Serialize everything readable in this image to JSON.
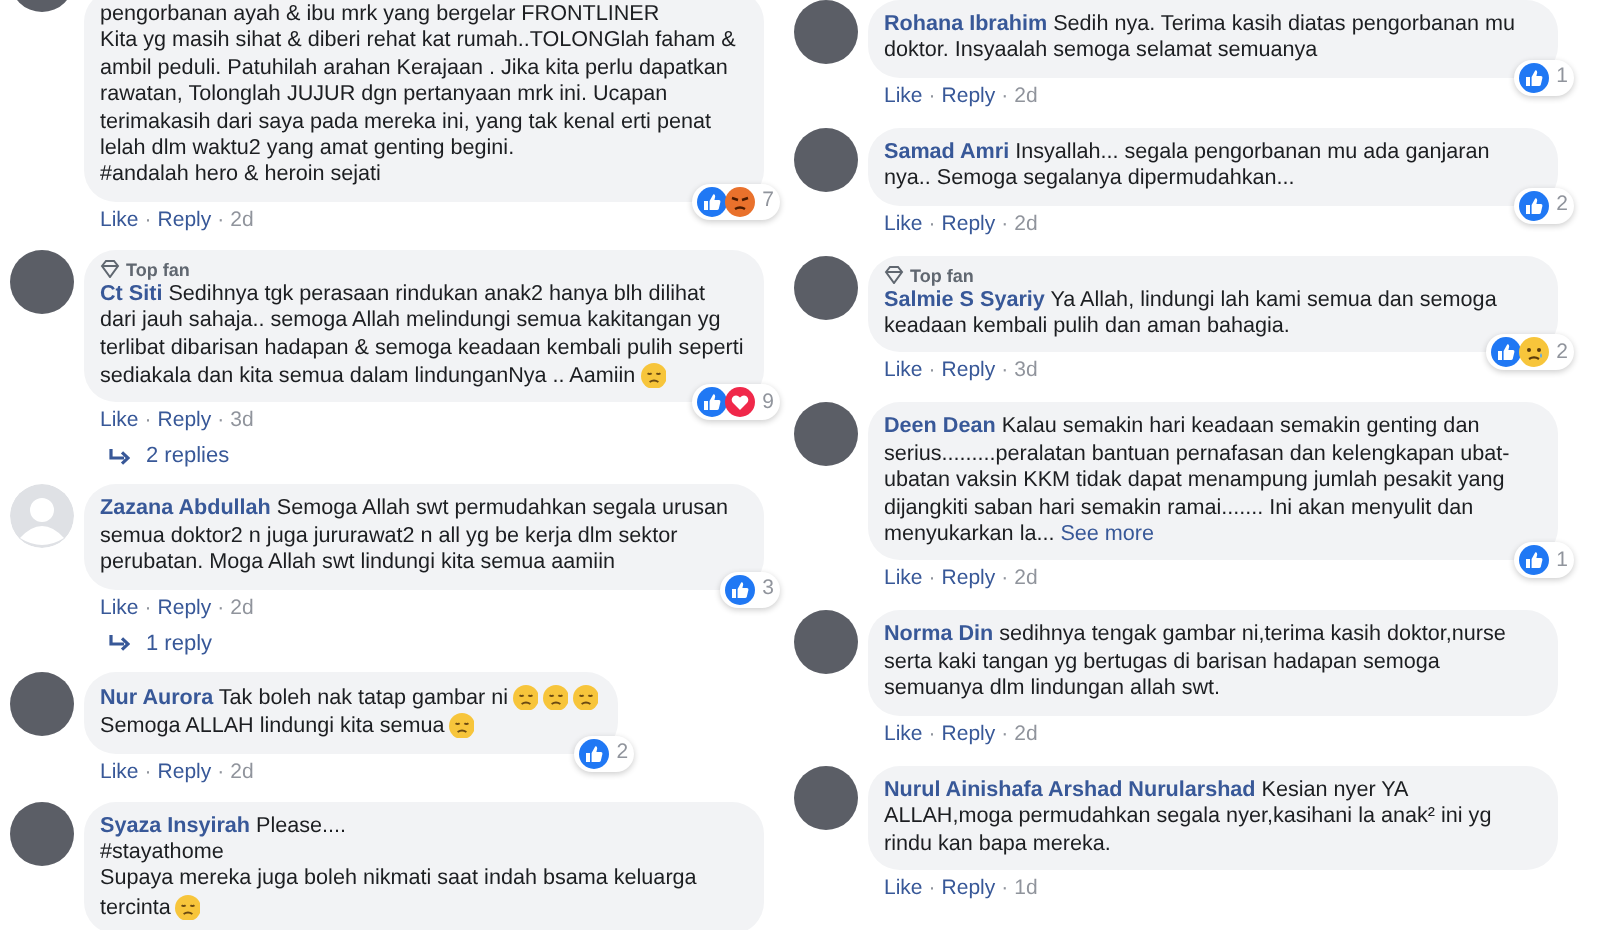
{
  "columns": [
    {
      "comments": [
        {
          "avatar": {
            "kind": "photo"
          },
          "paragraphs": [
            [
              {
                "kind": "text",
                "text": "pengorbanan ayah & ibu mrk yang bergelar FRONTLINER"
              }
            ],
            [
              {
                "kind": "text",
                "text": "Kita yg masih sihat & diberi rehat kat rumah..TOLONGlah faham & ambil peduli. Patuhilah arahan Kerajaan . Jika kita perlu dapatkan rawatan, Tolonglah JUJUR dgn pertanyaan mrk ini. Ucapan terimakasih dari saya pada mereka ini, yang tak kenal erti penat lelah dlm waktu2 yang amat genting begini."
              }
            ],
            [
              {
                "kind": "text",
                "text": "#andalah hero & heroin sejati"
              }
            ]
          ],
          "reactions": {
            "icons": [
              {
                "kind": "like"
              },
              {
                "kind": "angry"
              }
            ],
            "count": "7"
          },
          "actions": [
            {
              "kind": "link",
              "text": "Like"
            },
            {
              "kind": "sep",
              "text": "·"
            },
            {
              "kind": "link",
              "text": "Reply"
            },
            {
              "kind": "sep",
              "text": "·"
            },
            {
              "kind": "time",
              "text": "2d"
            }
          ]
        },
        {
          "author": "Ct Siti",
          "avatar": {
            "kind": "photo"
          },
          "top_fan_label": "Top fan",
          "paragraphs": [
            [
              {
                "kind": "text",
                "text": "Sedihnya tgk perasaan rindukan anak2 hanya blh dilihat dari jauh sahaja.. semoga Allah melindungi semua kakitangan yg terlibat dibarisan hadapan & semoga keadaan kembali pulih seperti sediakala dan kita semua dalam lindunganNya .. Aamiin"
              },
              {
                "kind": "emoji"
              }
            ]
          ],
          "reactions": {
            "icons": [
              {
                "kind": "like"
              },
              {
                "kind": "love"
              }
            ],
            "count": "9"
          },
          "actions": [
            {
              "kind": "link",
              "text": "Like"
            },
            {
              "kind": "sep",
              "text": "·"
            },
            {
              "kind": "link",
              "text": "Reply"
            },
            {
              "kind": "sep",
              "text": "·"
            },
            {
              "kind": "time",
              "text": "3d"
            }
          ],
          "replies": "2 replies"
        },
        {
          "author": "Zazana Abdullah",
          "avatar": {
            "kind": "default"
          },
          "paragraphs": [
            [
              {
                "kind": "text",
                "text": "Semoga Allah swt permudahkan segala urusan semua doktor2 n juga jururawat2 n all yg be kerja dlm sektor perubatan. Moga Allah swt lindungi kita semua aamiin"
              }
            ]
          ],
          "reactions": {
            "icons": [
              {
                "kind": "like"
              }
            ],
            "count": "3"
          },
          "actions": [
            {
              "kind": "link",
              "text": "Like"
            },
            {
              "kind": "sep",
              "text": "·"
            },
            {
              "kind": "link",
              "text": "Reply"
            },
            {
              "kind": "sep",
              "text": "·"
            },
            {
              "kind": "time",
              "text": "2d"
            }
          ],
          "replies": "1 reply"
        },
        {
          "author": "Nur Aurora",
          "avatar": {
            "kind": "photo"
          },
          "paragraphs": [
            [
              {
                "kind": "text",
                "text": "Tak boleh nak tatap gambar ni"
              },
              {
                "kind": "emoji"
              },
              {
                "kind": "emoji"
              },
              {
                "kind": "emoji"
              }
            ],
            [
              {
                "kind": "text",
                "text": "Semoga ALLAH lindungi kita semua"
              },
              {
                "kind": "emoji"
              }
            ]
          ],
          "reactions": {
            "icons": [
              {
                "kind": "like"
              }
            ],
            "count": "2"
          },
          "actions": [
            {
              "kind": "link",
              "text": "Like"
            },
            {
              "kind": "sep",
              "text": "·"
            },
            {
              "kind": "link",
              "text": "Reply"
            },
            {
              "kind": "sep",
              "text": "·"
            },
            {
              "kind": "time",
              "text": "2d"
            }
          ]
        },
        {
          "author": "Syaza Insyirah",
          "avatar": {
            "kind": "photo"
          },
          "paragraphs": [
            [
              {
                "kind": "text",
                "text": "Please...."
              }
            ],
            [
              {
                "kind": "text",
                "text": "#stayathome"
              }
            ],
            [
              {
                "kind": "text",
                "text": "Supaya mereka juga boleh nikmati saat indah bsama keluarga tercinta"
              },
              {
                "kind": "emoji"
              }
            ]
          ]
        }
      ]
    },
    {
      "comments": [
        {
          "author": "Rohana Ibrahim",
          "avatar": {
            "kind": "photo"
          },
          "paragraphs": [
            [
              {
                "kind": "text",
                "text": "Sedih nya. Terima kasih diatas pengorbanan mu doktor. Insyaalah semoga selamat semuanya"
              }
            ]
          ],
          "reactions": {
            "icons": [
              {
                "kind": "like"
              }
            ],
            "count": "1"
          },
          "actions": [
            {
              "kind": "link",
              "text": "Like"
            },
            {
              "kind": "sep",
              "text": "·"
            },
            {
              "kind": "link",
              "text": "Reply"
            },
            {
              "kind": "sep",
              "text": "·"
            },
            {
              "kind": "time",
              "text": "2d"
            }
          ]
        },
        {
          "author": "Samad Amri",
          "avatar": {
            "kind": "photo"
          },
          "paragraphs": [
            [
              {
                "kind": "text",
                "text": "Insyallah... segala pengorbanan mu ada ganjaran nya.. Semoga segalanya dipermudahkan..."
              }
            ]
          ],
          "reactions": {
            "icons": [
              {
                "kind": "like"
              }
            ],
            "count": "2"
          },
          "actions": [
            {
              "kind": "link",
              "text": "Like"
            },
            {
              "kind": "sep",
              "text": "·"
            },
            {
              "kind": "link",
              "text": "Reply"
            },
            {
              "kind": "sep",
              "text": "·"
            },
            {
              "kind": "time",
              "text": "2d"
            }
          ]
        },
        {
          "author": "Salmie S Syariy",
          "avatar": {
            "kind": "photo"
          },
          "top_fan_label": "Top fan",
          "paragraphs": [
            [
              {
                "kind": "text",
                "text": "Ya Allah, lindungi lah kami semua dan semoga keadaan kembali pulih dan aman bahagia."
              }
            ]
          ],
          "reactions": {
            "icons": [
              {
                "kind": "like"
              },
              {
                "kind": "sad"
              }
            ],
            "count": "2"
          },
          "actions": [
            {
              "kind": "link",
              "text": "Like"
            },
            {
              "kind": "sep",
              "text": "·"
            },
            {
              "kind": "link",
              "text": "Reply"
            },
            {
              "kind": "sep",
              "text": "·"
            },
            {
              "kind": "time",
              "text": "3d"
            }
          ]
        },
        {
          "author": "Deen Dean",
          "avatar": {
            "kind": "photo"
          },
          "paragraphs": [
            [
              {
                "kind": "text",
                "text": "Kalau semakin hari keadaan semakin genting dan serius.........peralatan bantuan pernafasan dan kelengkapan ubat-ubatan vaksin KKM tidak dapat menampung jumlah pesakit yang dijangkiti saban hari semakin ramai....... Ini akan menyulit dan menyukarkan la..."
              },
              {
                "kind": "link",
                "text": "See more"
              }
            ]
          ],
          "reactions": {
            "icons": [
              {
                "kind": "like"
              }
            ],
            "count": "1"
          },
          "actions": [
            {
              "kind": "link",
              "text": "Like"
            },
            {
              "kind": "sep",
              "text": "·"
            },
            {
              "kind": "link",
              "text": "Reply"
            },
            {
              "kind": "sep",
              "text": "·"
            },
            {
              "kind": "time",
              "text": "2d"
            }
          ]
        },
        {
          "author": "Norma Din",
          "avatar": {
            "kind": "photo"
          },
          "paragraphs": [
            [
              {
                "kind": "text",
                "text": "sedihnya tengak gambar ni,terima kasih doktor,nurse serta kaki tangan yg bertugas di barisan hadapan semoga semuanya dlm lindungan allah swt."
              }
            ]
          ],
          "actions": [
            {
              "kind": "link",
              "text": "Like"
            },
            {
              "kind": "sep",
              "text": "·"
            },
            {
              "kind": "link",
              "text": "Reply"
            },
            {
              "kind": "sep",
              "text": "·"
            },
            {
              "kind": "time",
              "text": "2d"
            }
          ]
        },
        {
          "author": "Nurul Ainishafa Arshad Nurularshad",
          "avatar": {
            "kind": "photo"
          },
          "paragraphs": [
            [
              {
                "kind": "text",
                "text": "Kesian nyer YA ALLAH,moga permudahkan segala nyer,kasihani la anak² ini yg rindu kan bapa mereka."
              }
            ]
          ],
          "actions": [
            {
              "kind": "link",
              "text": "Like"
            },
            {
              "kind": "sep",
              "text": "·"
            },
            {
              "kind": "link",
              "text": "Reply"
            },
            {
              "kind": "sep",
              "text": "·"
            },
            {
              "kind": "time",
              "text": "1d"
            }
          ]
        }
      ]
    }
  ]
}
